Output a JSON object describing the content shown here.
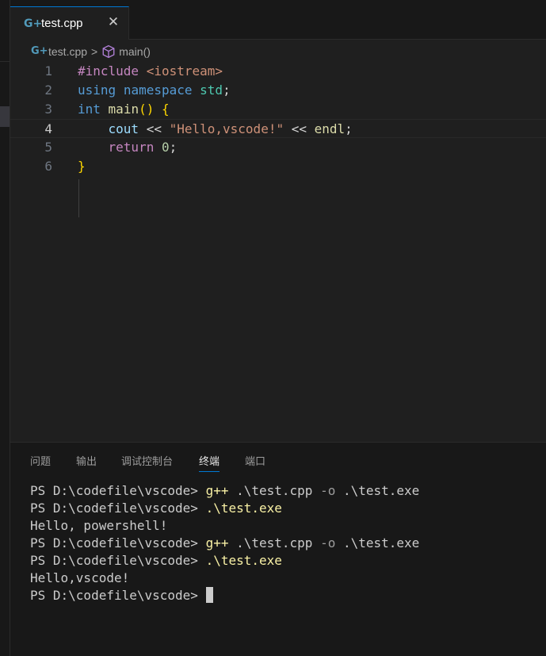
{
  "tab": {
    "label": "test.cpp",
    "icon": "cpp-file-icon",
    "close_glyph": "✕"
  },
  "breadcrumb": {
    "file": "test.cpp",
    "separator": ">",
    "symbol": "main()"
  },
  "editor": {
    "line_numbers": [
      "1",
      "2",
      "3",
      "4",
      "5",
      "6"
    ],
    "active_line": "4",
    "lines": [
      [
        {
          "t": "#include ",
          "c": "pp"
        },
        {
          "t": "<iostream>",
          "c": "str"
        }
      ],
      [
        {
          "t": "using",
          "c": "kw"
        },
        {
          "t": " ",
          "c": "op"
        },
        {
          "t": "namespace",
          "c": "kw"
        },
        {
          "t": " ",
          "c": "op"
        },
        {
          "t": "std",
          "c": "ns"
        },
        {
          "t": ";",
          "c": "op"
        }
      ],
      [
        {
          "t": "int",
          "c": "kw"
        },
        {
          "t": " ",
          "c": "op"
        },
        {
          "t": "main",
          "c": "fn"
        },
        {
          "t": "() {",
          "c": "br"
        }
      ],
      [
        {
          "t": "    ",
          "c": "op"
        },
        {
          "t": "cout",
          "c": "var"
        },
        {
          "t": " << ",
          "c": "op"
        },
        {
          "t": "\"Hello,vscode!\"",
          "c": "str"
        },
        {
          "t": " << ",
          "c": "op"
        },
        {
          "t": "endl",
          "c": "fn"
        },
        {
          "t": ";",
          "c": "op"
        }
      ],
      [
        {
          "t": "    ",
          "c": "op"
        },
        {
          "t": "return",
          "c": "ctl"
        },
        {
          "t": " ",
          "c": "op"
        },
        {
          "t": "0",
          "c": "num"
        },
        {
          "t": ";",
          "c": "op"
        }
      ],
      [
        {
          "t": "}",
          "c": "br"
        }
      ]
    ]
  },
  "panel": {
    "tabs": [
      "问题",
      "输出",
      "调试控制台",
      "终端",
      "端口"
    ],
    "active_tab": "终端"
  },
  "terminal": {
    "lines": [
      [
        {
          "t": "PS D:\\codefile\\vscode> ",
          "c": ""
        },
        {
          "t": "g++",
          "c": "cmd"
        },
        {
          "t": " .\\test.cpp ",
          "c": ""
        },
        {
          "t": "-o",
          "c": "flag"
        },
        {
          "t": " .\\test.exe",
          "c": ""
        }
      ],
      [
        {
          "t": "PS D:\\codefile\\vscode> ",
          "c": ""
        },
        {
          "t": ".\\test.exe",
          "c": "cmd"
        }
      ],
      [
        {
          "t": "Hello, powershell!",
          "c": ""
        }
      ],
      [
        {
          "t": "PS D:\\codefile\\vscode> ",
          "c": ""
        },
        {
          "t": "g++",
          "c": "cmd"
        },
        {
          "t": " .\\test.cpp ",
          "c": ""
        },
        {
          "t": "-o",
          "c": "flag"
        },
        {
          "t": " .\\test.exe",
          "c": ""
        }
      ],
      [
        {
          "t": "PS D:\\codefile\\vscode> ",
          "c": ""
        },
        {
          "t": ".\\test.exe",
          "c": "cmd"
        }
      ],
      [
        {
          "t": "Hello,vscode!",
          "c": ""
        }
      ],
      [
        {
          "t": "PS D:\\codefile\\vscode> ",
          "c": ""
        }
      ]
    ]
  },
  "colors": {
    "accent": "#0078d4",
    "editor_bg": "#1f1f1f",
    "panel_bg": "#181818",
    "cpp_icon": "#519aba"
  }
}
